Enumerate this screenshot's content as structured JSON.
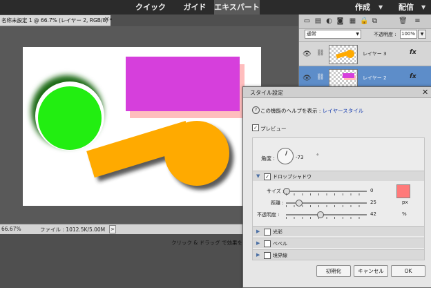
{
  "topbar": {
    "modes": {
      "quick": "クイック",
      "guided": "ガイド",
      "expert": "エキスパート"
    },
    "create_label": "作成",
    "share_label": "配信"
  },
  "document": {
    "tab_title": "名称未設定 1 @ 66.7% (レイヤー 2, RGB/8) *",
    "close_glyph": "×"
  },
  "status": {
    "zoom": "66.67%",
    "file_info": "ファイル : 1012.5K/5.00M",
    "arrow": ">",
    "hint": "クリック & ドラッグ で効果を元に戻しま"
  },
  "layers_panel": {
    "blend_mode": "通常",
    "opacity_label": "不透明度 :",
    "opacity_value": "100%",
    "layers": [
      {
        "name": "レイヤー 3",
        "fx": "fx",
        "selected": false
      },
      {
        "name": "レイヤー 2",
        "fx": "fx",
        "selected": true
      }
    ]
  },
  "style_dialog": {
    "title": "スタイル設定",
    "help_prefix": "この機能のヘルプを表示 : ",
    "help_link": "レイヤースタイル",
    "preview_label": "プレビュー",
    "preview_checked": true,
    "angle_label": "角度 :",
    "angle_value": "-73",
    "angle_unit": "°",
    "drop_shadow": {
      "label": "ドロップシャドウ",
      "checked": true,
      "color": "#ff7a7a",
      "sliders": [
        {
          "label": "サイズ :",
          "value": "0",
          "unit": "px",
          "fraction": 0.0
        },
        {
          "label": "距離 :",
          "value": "25",
          "unit": "px",
          "fraction": 0.15
        },
        {
          "label": "不透明度 :",
          "value": "42",
          "unit": "%",
          "fraction": 0.42
        }
      ]
    },
    "sections": [
      {
        "label": "光彩",
        "checked": false
      },
      {
        "label": "ベベル",
        "checked": false
      },
      {
        "label": "境界線",
        "checked": false
      }
    ],
    "buttons": {
      "reset": "初期化",
      "cancel": "キャンセル",
      "ok": "OK"
    }
  },
  "colors": {
    "magenta": "#d63fdc",
    "green": "#22ee11",
    "orange": "#ffaa00",
    "pink_shadow": "#ffbdbd"
  }
}
